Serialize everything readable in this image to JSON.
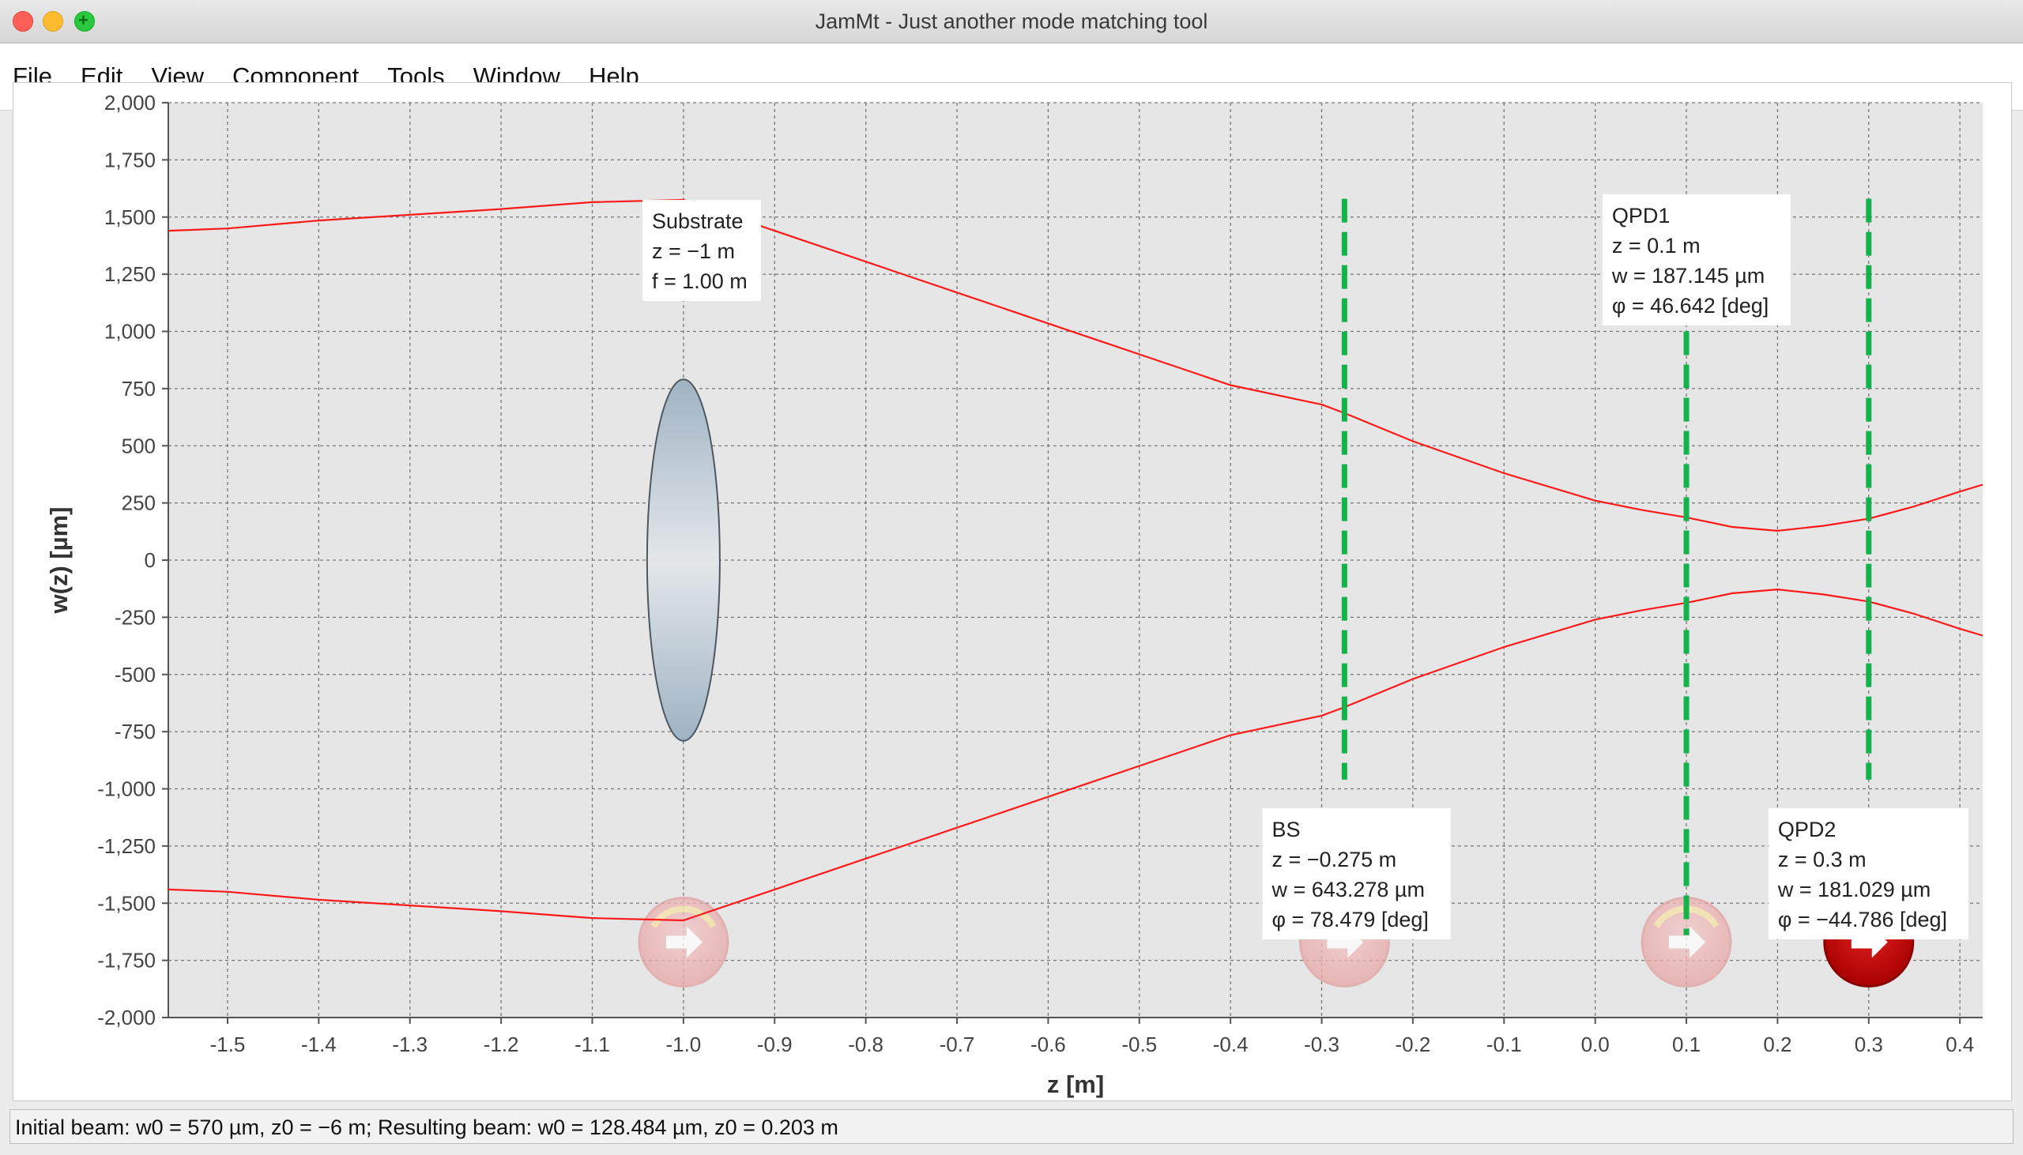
{
  "window": {
    "title": "JamMt - Just another mode matching tool"
  },
  "menu": [
    "File",
    "Edit",
    "View",
    "Component",
    "Tools",
    "Window",
    "Help"
  ],
  "chart_data": {
    "type": "line",
    "xlabel": "z [m]",
    "ylabel": "w(z) [µm]",
    "xlim": [
      -1.565,
      0.425
    ],
    "ylim": [
      -2000,
      2000
    ],
    "x_ticks": [
      -1.5,
      -1.4,
      -1.3,
      -1.2,
      -1.1,
      -1.0,
      -0.9,
      -0.8,
      -0.7,
      -0.6,
      -0.5,
      -0.4,
      -0.3,
      -0.2,
      -0.1,
      0.0,
      0.1,
      0.2,
      0.3,
      0.4
    ],
    "x_tick_labels": [
      "-1.5",
      "-1.4",
      "-1.3",
      "-1.2",
      "-1.1",
      "-1.0",
      "-0.9",
      "-0.8",
      "-0.7",
      "-0.6",
      "-0.5",
      "-0.4",
      "-0.3",
      "-0.2",
      "-0.1",
      "0.0",
      "0.1",
      "0.2",
      "0.3",
      "0.4"
    ],
    "y_ticks": [
      2000,
      1750,
      1500,
      1250,
      1000,
      750,
      500,
      250,
      0,
      -250,
      -500,
      -750,
      -1000,
      -1250,
      -1500,
      -1750,
      -2000
    ],
    "y_tick_labels": [
      "2,000",
      "1,750",
      "1,500",
      "1,250",
      "1,000",
      "750",
      "500",
      "250",
      "0",
      "-250",
      "-500",
      "-750",
      "-1,000",
      "-1,250",
      "-1,500",
      "-1,750",
      "-2,000"
    ],
    "grid": true,
    "beam_envelope": {
      "color": "#ff1a1a",
      "x": [
        -1.565,
        -1.5,
        -1.4,
        -1.3,
        -1.2,
        -1.1,
        -1.0,
        -0.9,
        -0.8,
        -0.7,
        -0.6,
        -0.5,
        -0.4,
        -0.3,
        -0.275,
        -0.2,
        -0.1,
        0.0,
        0.05,
        0.1,
        0.15,
        0.2,
        0.25,
        0.3,
        0.35,
        0.4,
        0.425
      ],
      "w": [
        1440,
        1450,
        1485,
        1510,
        1535,
        1565,
        1575,
        1440,
        1305,
        1170,
        1035,
        900,
        765,
        680,
        643,
        520,
        380,
        260,
        220,
        187,
        145,
        128,
        150,
        181,
        235,
        300,
        330
      ]
    },
    "lens": {
      "name": "Substrate",
      "z": -1.0,
      "w_half": 790,
      "label_lines": [
        "Substrate",
        "z = −1 m",
        "f = 1.00 m"
      ]
    },
    "detectors": [
      {
        "name": "BS",
        "z": -0.275,
        "label_lines": [
          "BS",
          "z = −0.275 m",
          "w = 643.278 µm",
          "φ = 78.479 [deg]"
        ],
        "color": "#13b24a"
      },
      {
        "name": "QPD1",
        "z": 0.1,
        "label_lines": [
          "QPD1",
          "z = 0.1 m",
          "w = 187.145 µm",
          "φ = 46.642 [deg]"
        ],
        "color": "#13b24a"
      },
      {
        "name": "QPD2",
        "z": 0.3,
        "label_lines": [
          "QPD2",
          "z = 0.3 m",
          "w = 181.029 µm",
          "φ = −44.786 [deg]"
        ],
        "color": "#13b24a"
      }
    ]
  },
  "status": {
    "text": "Initial beam: w0 = 570 µm, z0 = −6 m; Resulting beam: w0 = 128.484 µm, z0 = 0.203 m"
  }
}
